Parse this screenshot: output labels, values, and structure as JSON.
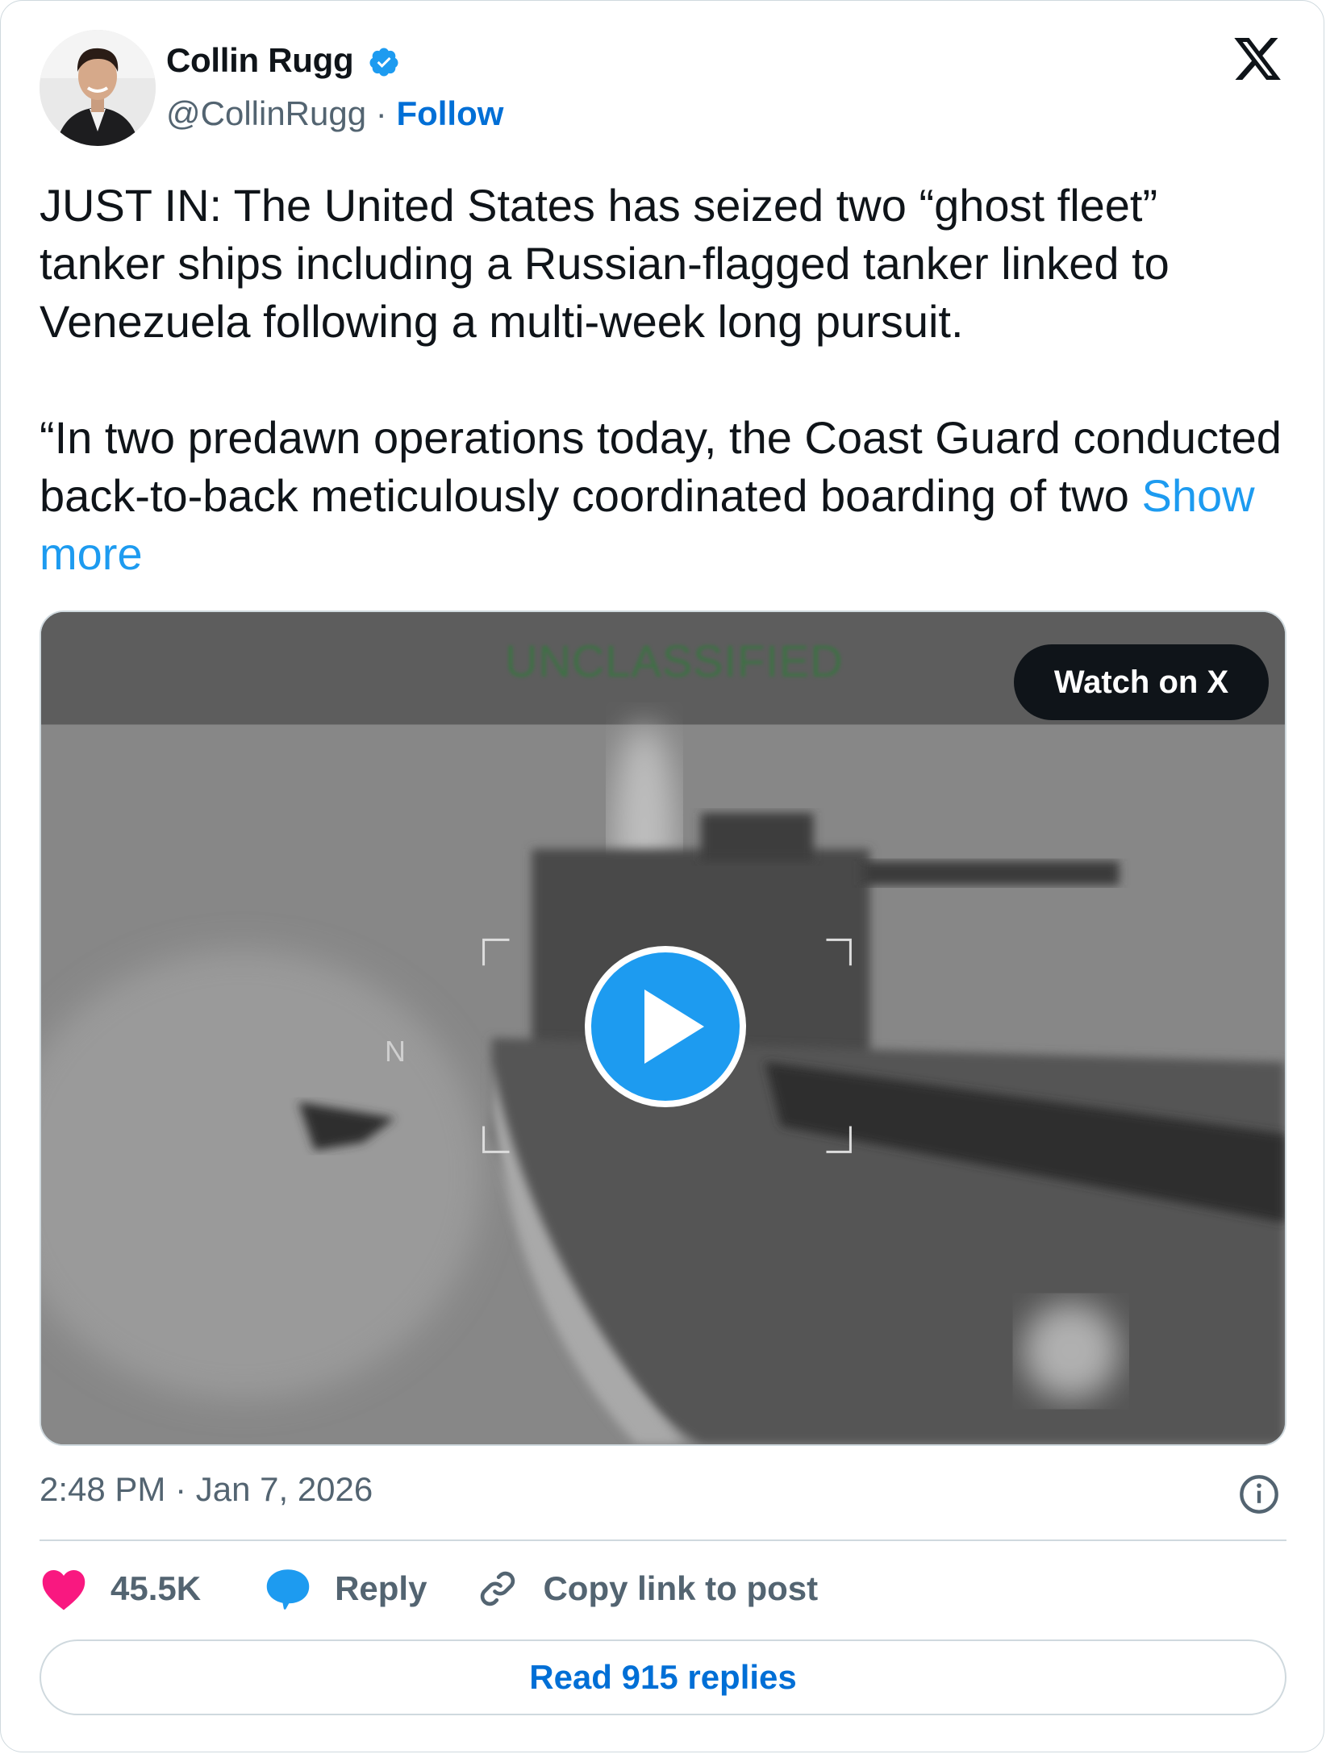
{
  "author": {
    "name": "Collin Rugg",
    "handle": "@CollinRugg",
    "separator": "·",
    "follow_label": "Follow"
  },
  "icons": {
    "verified": "verified-badge-icon",
    "logo": "x-logo-icon",
    "info": "info-icon",
    "like": "heart-icon",
    "reply": "reply-bubble-icon",
    "link": "link-icon",
    "play": "play-icon"
  },
  "tweet": {
    "paragraph1": "JUST IN: The United States has seized two “ghost fleet” tanker ships including a Russian-flagged tanker linked to Venezuela following a multi-week long pursuit.",
    "paragraph2": "“In two predawn operations today, the Coast Guard conducted back-to-back meticulously coordinated boarding of two ",
    "show_more": "Show more"
  },
  "media": {
    "overlay_text": "UNCLASSIFIED",
    "compass_label": "N",
    "watch_label": "Watch on X"
  },
  "meta": {
    "timestamp": "2:48 PM · Jan 7, 2026"
  },
  "actions": {
    "likes": "45.5K",
    "reply_label": "Reply",
    "copy_label": "Copy link to post"
  },
  "read_replies_label": "Read 915 replies",
  "colors": {
    "accent_blue": "#1d9bf0",
    "link_blue": "#006fd6",
    "like_pink": "#f91880",
    "muted_text": "#536471",
    "border": "#cfd9de"
  }
}
